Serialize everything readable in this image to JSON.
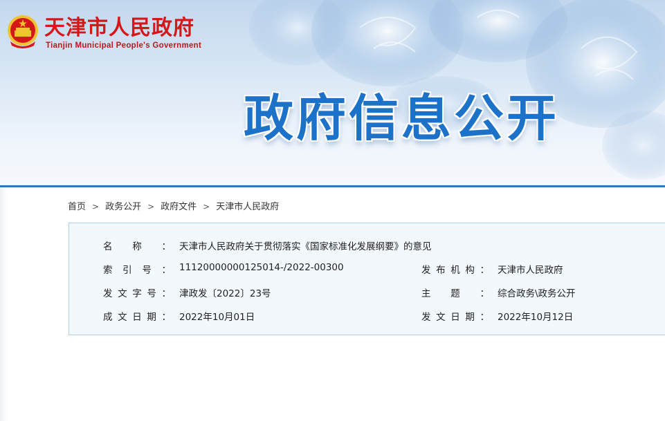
{
  "header": {
    "gov_name_cn": "天津市人民政府",
    "gov_name_en": "Tianjin Municipal People's Government",
    "banner_title": "政府信息公开"
  },
  "breadcrumb": {
    "items": [
      "首页",
      "政务公开",
      "政府文件",
      "天津市人民政府"
    ],
    "separator": ">"
  },
  "info": {
    "name_label": [
      "名",
      "称",
      "："
    ],
    "name_value": "天津市人民政府关于贯彻落实《国家标准化发展纲要》的意见",
    "index_label": [
      "索",
      "引",
      "号",
      "："
    ],
    "index_value": "11120000000125014-/2022-00300",
    "publisher_label": [
      "发",
      "布",
      "机",
      "构",
      "："
    ],
    "publisher_value": "天津市人民政府",
    "doc_no_label": [
      "发",
      "文",
      "字",
      "号",
      "："
    ],
    "doc_no_value": "津政发〔2022〕23号",
    "subject_label": [
      "主",
      "题",
      "："
    ],
    "subject_value": "综合政务\\政务公开",
    "created_label": [
      "成",
      "文",
      "日",
      "期",
      "："
    ],
    "created_value": "2022年10月01日",
    "published_label": [
      "发",
      "文",
      "日",
      "期",
      "："
    ],
    "published_value": "2022年10月12日"
  },
  "colors": {
    "header_red": "#d5171a",
    "title_blue": "#1b72c8",
    "rule_blue": "#2e76be",
    "box_bg": "#f3f8fd",
    "box_border": "#b2cfe6"
  }
}
